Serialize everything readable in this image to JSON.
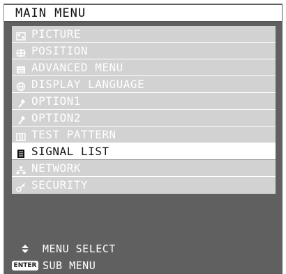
{
  "menu": {
    "title": "MAIN MENU",
    "items": [
      {
        "label": "PICTURE",
        "icon": "picture-icon"
      },
      {
        "label": "POSITION",
        "icon": "position-icon"
      },
      {
        "label": "ADVANCED MENU",
        "icon": "advanced-menu-icon"
      },
      {
        "label": "DISPLAY LANGUAGE",
        "icon": "globe-icon"
      },
      {
        "label": "OPTION1",
        "icon": "wrench-icon"
      },
      {
        "label": "OPTION2",
        "icon": "wrench-icon"
      },
      {
        "label": "TEST PATTERN",
        "icon": "test-pattern-icon"
      },
      {
        "label": "SIGNAL LIST",
        "icon": "signal-list-icon",
        "selected": true
      },
      {
        "label": "NETWORK",
        "icon": "network-icon"
      },
      {
        "label": "SECURITY",
        "icon": "key-icon"
      }
    ]
  },
  "footer": {
    "select_label": "MENU SELECT",
    "select_icon": "up-down-arrows-icon",
    "enter_key": "ENTER",
    "enter_label": "SUB MENU"
  },
  "colors": {
    "osd_background": "#606060",
    "item_background": "#d2d2d2",
    "selected_background": "#ffffff"
  }
}
